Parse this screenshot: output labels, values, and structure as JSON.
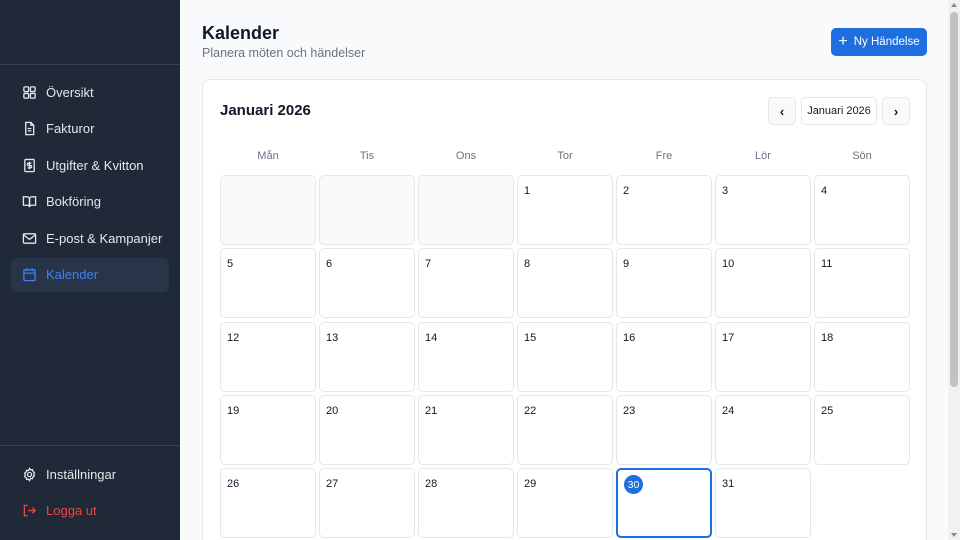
{
  "sidebar": {
    "items": [
      {
        "label": "Översikt",
        "icon": "grid-icon"
      },
      {
        "label": "Fakturor",
        "icon": "document-icon"
      },
      {
        "label": "Utgifter & Kvitton",
        "icon": "receipt-icon"
      },
      {
        "label": "Bokföring",
        "icon": "book-icon"
      },
      {
        "label": "E-post & Kampanjer",
        "icon": "mail-icon"
      },
      {
        "label": "Kalender",
        "icon": "calendar-icon",
        "active": true
      }
    ],
    "bottom": [
      {
        "label": "Inställningar",
        "icon": "gear-icon"
      },
      {
        "label": "Logga ut",
        "icon": "logout-icon"
      }
    ],
    "active_color": "#3b82f6",
    "logout_color": "#ef4444"
  },
  "header": {
    "title": "Kalender",
    "subtitle": "Planera möten och händelser",
    "new_event_label": "Ny Händelse"
  },
  "calendar": {
    "month_title": "Januari 2026",
    "nav_month_label": "Januari 2026",
    "weekdays": [
      "Mån",
      "Tis",
      "Ons",
      "Tor",
      "Fre",
      "Lör",
      "Sön"
    ],
    "leading_empty": 3,
    "days": [
      "1",
      "2",
      "3",
      "4",
      "5",
      "6",
      "7",
      "8",
      "9",
      "10",
      "11",
      "12",
      "13",
      "14",
      "15",
      "16",
      "17",
      "18",
      "19",
      "20",
      "21",
      "22",
      "23",
      "24",
      "25",
      "26",
      "27",
      "28",
      "29",
      "30",
      "31"
    ],
    "today": "30",
    "accent_color": "#1d6fe0"
  }
}
